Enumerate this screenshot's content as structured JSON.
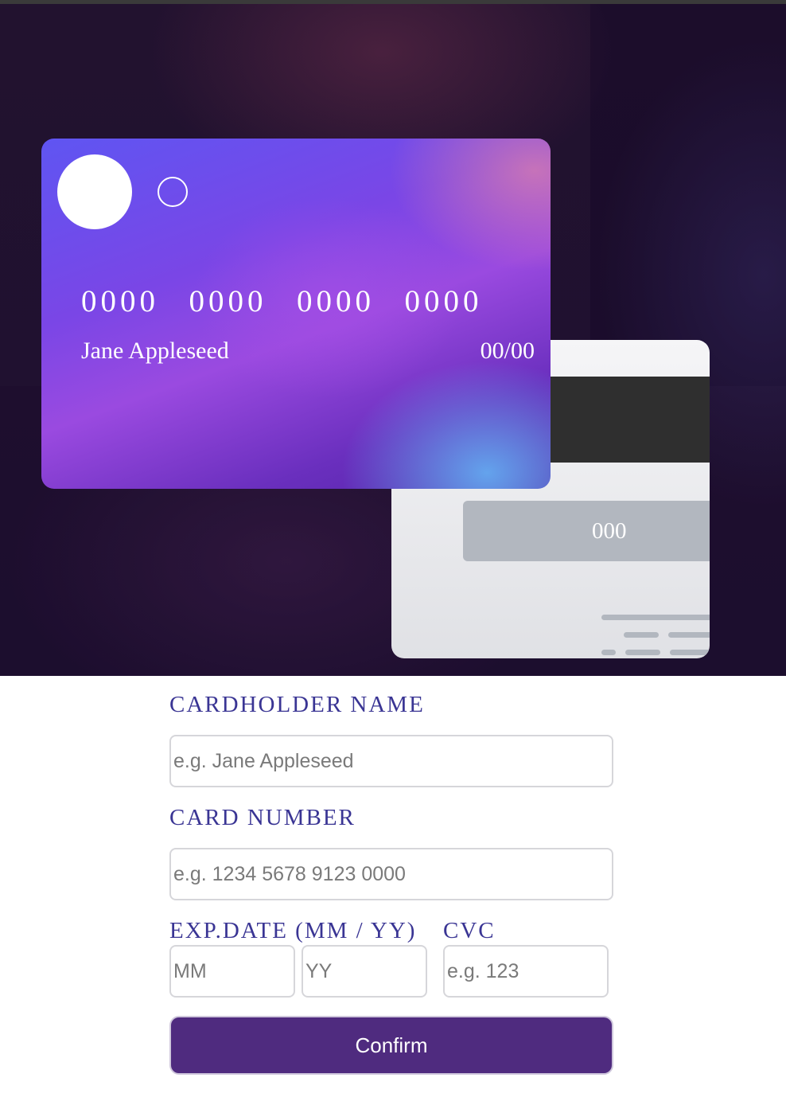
{
  "card_front": {
    "number": "0000  0000  0000  0000",
    "name": "Jane Appleseed",
    "expiry": "00/00"
  },
  "card_back": {
    "cvc": "000"
  },
  "form": {
    "name_label": "CARDHOLDER NAME",
    "name_placeholder": "e.g. Jane Appleseed",
    "number_label": "CARD NUMBER",
    "number_placeholder": "e.g. 1234 5678 9123 0000",
    "exp_label": "EXP.DATE (MM / YY)",
    "mm_placeholder": "MM",
    "yy_placeholder": "YY",
    "cvc_label": "CVC",
    "cvc_placeholder": "e.g. 123",
    "confirm_label": "Confirm"
  }
}
